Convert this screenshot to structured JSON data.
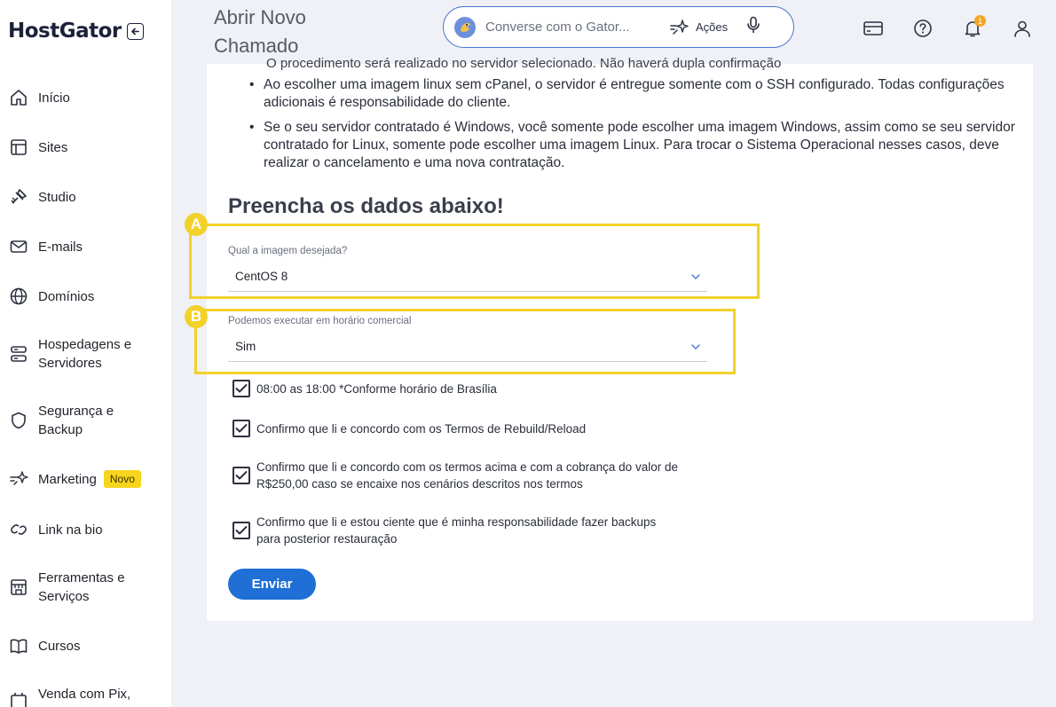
{
  "sidebar": {
    "logo": "HostGator",
    "items": [
      {
        "label": "Início",
        "icon": "home-icon"
      },
      {
        "label": "Sites",
        "icon": "layout-icon"
      },
      {
        "label": "Studio",
        "icon": "studio-icon"
      },
      {
        "label": "E-mails",
        "icon": "mail-icon"
      },
      {
        "label": "Domínios",
        "icon": "globe-icon"
      },
      {
        "label": "Hospedagens e Servidores",
        "icon": "server-icon"
      },
      {
        "label": "Segurança e Backup",
        "icon": "shield-icon"
      },
      {
        "label": "Marketing",
        "icon": "marketing-icon",
        "badge": "Novo"
      },
      {
        "label": "Link na bio",
        "icon": "link-icon"
      },
      {
        "label": "Ferramentas e Serviços",
        "icon": "store-icon"
      },
      {
        "label": "Cursos",
        "icon": "book-icon"
      },
      {
        "label": "Venda com Pix,",
        "icon": "cart-icon"
      }
    ]
  },
  "header": {
    "title": "Abrir Novo Chamado",
    "search_placeholder": "Converse com o Gator...",
    "actions_label": "Ações",
    "notification_count": "1"
  },
  "content": {
    "cut_line": "O procedimento será realizado no servidor selecionado. Não haverá dupla confirmação",
    "bullets": [
      "Ao escolher uma imagem linux sem cPanel, o servidor é entregue somente com o SSH configurado. Todas configurações adicionais é responsabilidade do cliente.",
      "Se o seu servidor contratado é Windows, você somente pode escolher uma imagem Windows, assim como se seu servidor contratado for Linux, somente pode escolher uma imagem Linux. Para trocar o Sistema Operacional nesses casos, deve realizar o cancelamento e uma nova contratação."
    ],
    "section_title": "Preencha os dados abaixo!",
    "field_image": {
      "label": "Qual a imagem desejada?",
      "value": "CentOS 8"
    },
    "field_schedule": {
      "label": "Podemos executar em horário comercial",
      "value": "Sim"
    },
    "checks": [
      "08:00 as 18:00 *Conforme horário de Brasília",
      "Confirmo que li e concordo com os Termos de Rebuild/Reload",
      "Confirmo que li e concordo com os termos acima e com a cobrança do valor de R$250,00 caso se encaixe nos cenários descritos nos termos",
      "Confirmo que li e estou ciente que é minha responsabilidade fazer backups para posterior restauração"
    ],
    "submit_label": "Enviar",
    "annotations": [
      "A",
      "B"
    ]
  },
  "colors": {
    "highlight": "#f2d12a",
    "primary": "#1f6fd6",
    "badge_novo": "#f7d51d"
  }
}
